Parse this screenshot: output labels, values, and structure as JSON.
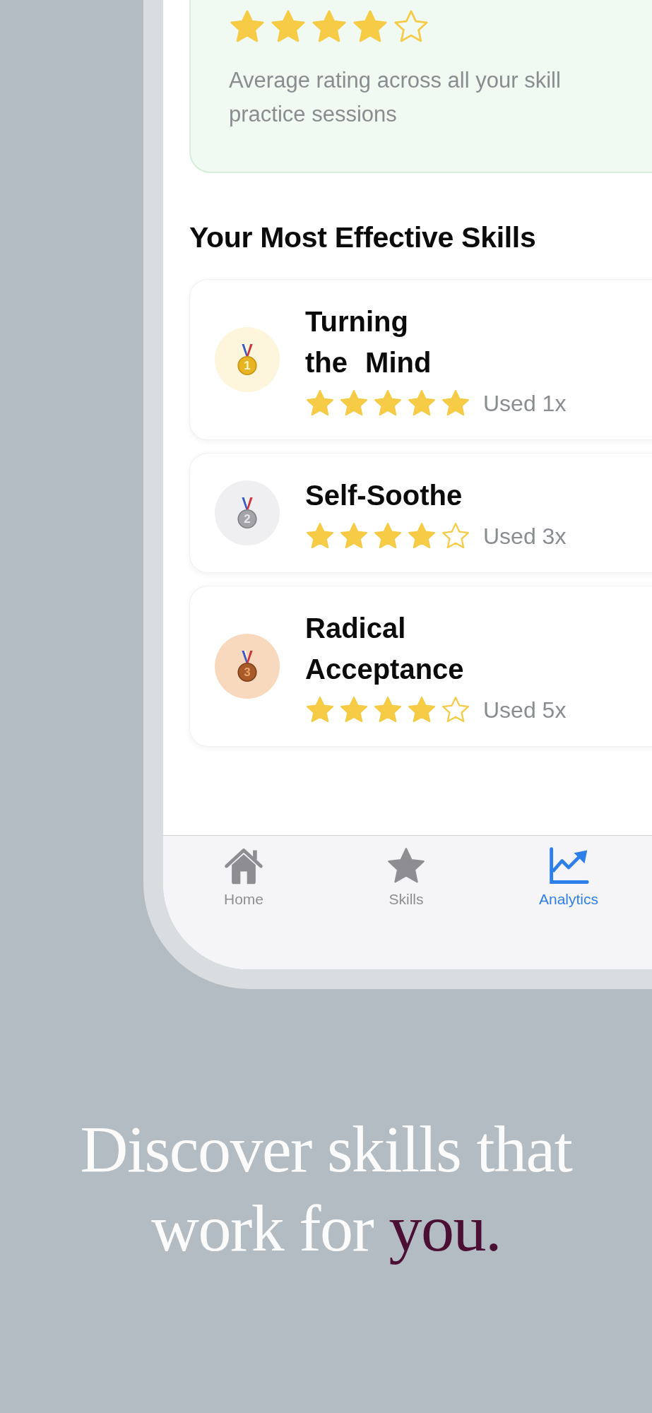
{
  "summary_card": {
    "stars": 4,
    "description": "Average rating across all your skill practice sessions"
  },
  "section_title": "Your Most Effective Skills",
  "skills": [
    {
      "kind": "gold",
      "rank": "1",
      "name": "Turning the Mind",
      "stars": 5,
      "usage": "Used 1x"
    },
    {
      "kind": "silver",
      "rank": "2",
      "name": "Self-Soothe",
      "stars": 4,
      "usage": "Used 3x"
    },
    {
      "kind": "bronze",
      "rank": "3",
      "name": "Radical Acceptance",
      "stars": 4,
      "usage": "Used 5x"
    }
  ],
  "tabs": [
    {
      "kind": "home",
      "label": "Home",
      "selected": false
    },
    {
      "kind": "skills",
      "label": "Skills",
      "selected": false
    },
    {
      "kind": "analytics",
      "label": "Analytics",
      "selected": true
    }
  ],
  "caption": {
    "lines": [
      [
        {
          "text": "Discover skills that",
          "accent": false
        }
      ],
      [
        {
          "text": "work for ",
          "accent": false
        },
        {
          "text": "you.",
          "accent": true
        }
      ]
    ]
  }
}
